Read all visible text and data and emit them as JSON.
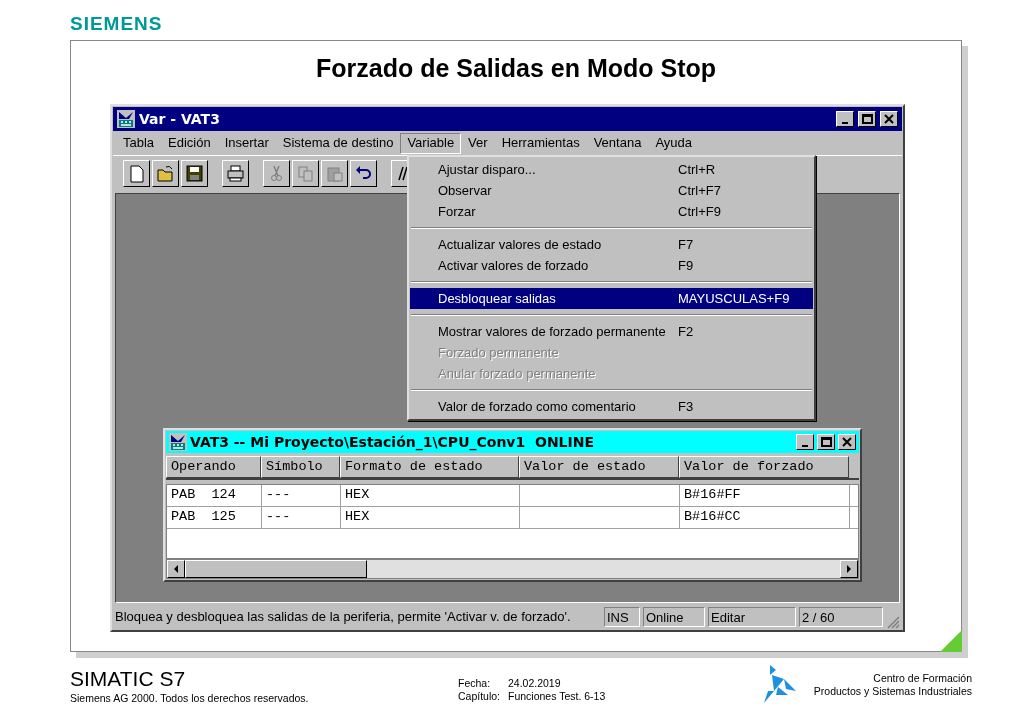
{
  "brand": "SIEMENS",
  "slide_title": "Forzado de Salidas en Modo Stop",
  "window": {
    "title": "Var - VAT3",
    "menu": [
      {
        "label": "Tabla",
        "selected": false
      },
      {
        "label": "Edición",
        "selected": false
      },
      {
        "label": "Insertar",
        "selected": false
      },
      {
        "label": "Sistema de destino",
        "selected": false
      },
      {
        "label": "Variable",
        "selected": true
      },
      {
        "label": "Ver",
        "selected": false
      },
      {
        "label": "Herramientas",
        "selected": false
      },
      {
        "label": "Ventana",
        "selected": false
      },
      {
        "label": "Ayuda",
        "selected": false
      }
    ],
    "toolbar": [
      {
        "kind": "new"
      },
      {
        "kind": "open"
      },
      {
        "kind": "save"
      },
      {
        "kind": "gap"
      },
      {
        "kind": "print"
      },
      {
        "kind": "gap"
      },
      {
        "kind": "cut",
        "disabled": true
      },
      {
        "kind": "copy",
        "disabled": true
      },
      {
        "kind": "paste",
        "disabled": true
      },
      {
        "kind": "undo",
        "disabled": false
      },
      {
        "kind": "gap"
      },
      {
        "kind": "comment"
      }
    ],
    "dropdown": [
      {
        "kind": "item",
        "label": "Ajustar disparo...",
        "shortcut": "Ctrl+R",
        "selected": false,
        "disabled": false
      },
      {
        "kind": "item",
        "label": "Observar",
        "shortcut": "Ctrl+F7",
        "selected": false,
        "disabled": false
      },
      {
        "kind": "item",
        "label": "Forzar",
        "shortcut": "Ctrl+F9",
        "selected": false,
        "disabled": false
      },
      {
        "kind": "separator"
      },
      {
        "kind": "item",
        "label": "Actualizar valores de estado",
        "shortcut": "F7",
        "selected": false,
        "disabled": false
      },
      {
        "kind": "item",
        "label": "Activar valores de forzado",
        "shortcut": "F9",
        "selected": false,
        "disabled": false
      },
      {
        "kind": "separator"
      },
      {
        "kind": "item",
        "label": "Desbloquear salidas",
        "shortcut": "MAYUSCULAS+F9",
        "selected": true,
        "disabled": false
      },
      {
        "kind": "separator"
      },
      {
        "kind": "item",
        "label": "Mostrar valores de forzado permanente",
        "shortcut": "F2",
        "selected": false,
        "disabled": false
      },
      {
        "kind": "item",
        "label": "Forzado permanente",
        "selected": false,
        "disabled": true
      },
      {
        "kind": "item",
        "label": "Anular forzado permanente",
        "selected": false,
        "disabled": true
      },
      {
        "kind": "separator"
      },
      {
        "kind": "item",
        "label": "Valor de forzado como comentario",
        "shortcut": "F3",
        "selected": false,
        "disabled": false
      }
    ],
    "child": {
      "title": "VAT3 -- Mi Proyecto\\Estación_1\\CPU_Conv1  ONLINE",
      "columns": [
        "Operando",
        "Símbolo",
        "Formato de estado",
        "Valor de estado",
        "Valor de forzado"
      ],
      "rows": [
        {
          "operando": "PAB  124",
          "simbolo": "---",
          "formato": "HEX",
          "forzado": "B#16#FF"
        },
        {
          "operando": "PAB  125",
          "simbolo": "---",
          "formato": "HEX",
          "forzado": "B#16#CC"
        }
      ]
    },
    "status_bar": {
      "message": "Bloquea y desbloquea las salidas de la periferia, permite 'Activar v. de forzado'.",
      "panes": [
        "INS",
        "Online",
        "Editar",
        "2 / 60"
      ]
    }
  },
  "footer": {
    "product": "SIMATIC S7",
    "copyright": "Siemens AG 2000. Todos los derechos reservados.",
    "date_label": "Fecha:",
    "date": "24.02.2019",
    "chapter_label": "Capítulo:",
    "chapter": "Funciones Test. 6-13",
    "org_line_1": "Centro de Formación",
    "org_line_2": "Productos y Sistemas Industriales"
  }
}
